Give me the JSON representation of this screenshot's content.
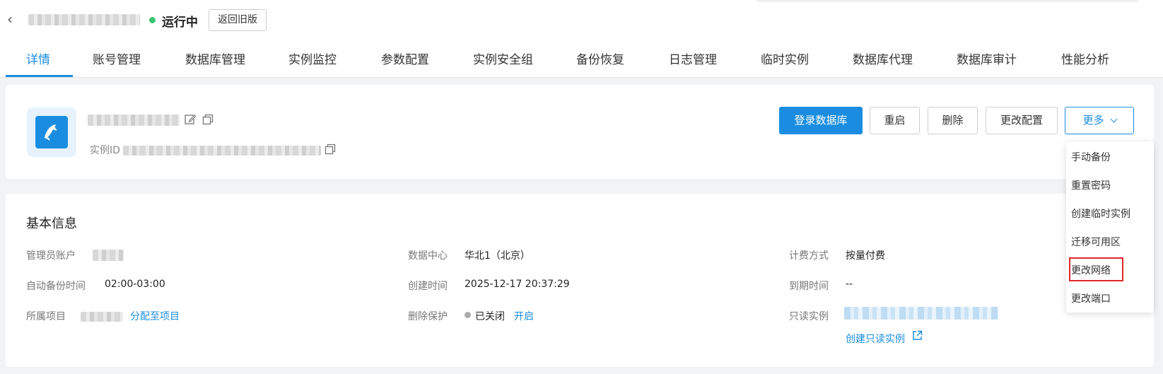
{
  "header": {
    "status_text": "运行中",
    "old_version_button": "返回旧版"
  },
  "tabs": [
    {
      "label": "详情"
    },
    {
      "label": "账号管理"
    },
    {
      "label": "数据库管理"
    },
    {
      "label": "实例监控"
    },
    {
      "label": "参数配置"
    },
    {
      "label": "实例安全组"
    },
    {
      "label": "备份恢复"
    },
    {
      "label": "日志管理"
    },
    {
      "label": "临时实例"
    },
    {
      "label": "数据库代理"
    },
    {
      "label": "数据库审计"
    },
    {
      "label": "性能分析"
    }
  ],
  "instance": {
    "id_label": "实例ID"
  },
  "actions": {
    "login": "登录数据库",
    "restart": "重启",
    "delete": "删除",
    "change_config": "更改配置",
    "more": "更多"
  },
  "more_menu": [
    {
      "label": "手动备份"
    },
    {
      "label": "重置密码"
    },
    {
      "label": "创建临时实例"
    },
    {
      "label": "迁移可用区"
    },
    {
      "label": "更改网络"
    },
    {
      "label": "更改端口"
    }
  ],
  "basic_info": {
    "title": "基本信息",
    "admin_account_label": "管理员账户",
    "auto_backup_label": "自动备份时间",
    "auto_backup_value": "02:00-03:00",
    "project_label": "所属项目",
    "assign_project_link": "分配至项目",
    "datacenter_label": "数据中心",
    "datacenter_value": "华北1（北京）",
    "create_time_label": "创建时间",
    "create_time_value": "2025-12-17 20:37:29",
    "delete_protect_label": "删除保护",
    "delete_protect_value": "已关闭",
    "delete_protect_link": "开启",
    "billing_label": "计费方式",
    "billing_value": "按量付费",
    "expire_label": "到期时间",
    "expire_value": "--",
    "readonly_label": "只读实例",
    "create_readonly_link": "创建只读实例"
  },
  "colors": {
    "accent": "#1a8de0",
    "status_running": "#3cc56f",
    "highlight_border": "#e0262b"
  }
}
